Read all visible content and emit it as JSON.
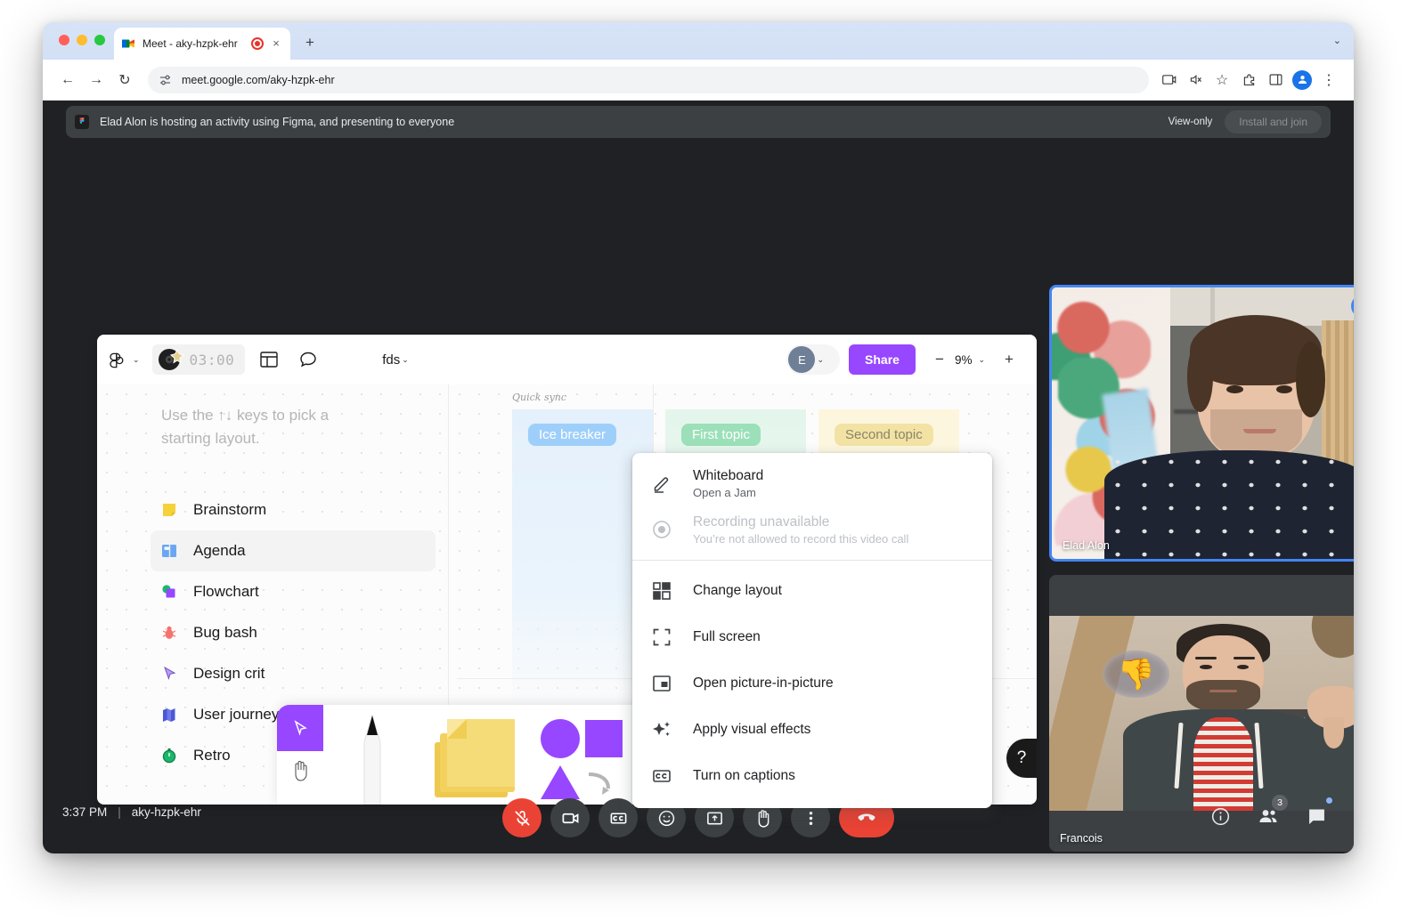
{
  "browser": {
    "tab": {
      "title": "Meet - aky-hzpk-ehr",
      "favicon": "google-meet-icon",
      "recording_indicator": "recording-icon",
      "close": "×"
    },
    "new_tab": "+",
    "chevron": "⌄",
    "nav": {
      "back": "←",
      "forward": "→",
      "reload": "↻"
    },
    "omnibox": {
      "url": "meet.google.com/aky-hzpk-ehr",
      "site_settings_icon": "tune-icon"
    },
    "actions": {
      "cast": "screencast-icon",
      "mute_tab": "tab-muted-icon",
      "bookmark": "☆",
      "extensions": "extensions-icon",
      "side_panel": "side-panel-icon",
      "profile": "profile-avatar-icon",
      "menu": "⋮"
    }
  },
  "banner": {
    "icon": "figma-icon",
    "text": "Elad Alon is hosting an activity using Figma, and presenting to everyone",
    "view_only": "View-only",
    "install_button": "Install and join"
  },
  "figma": {
    "logo": "figma-logo-icon",
    "timer": "03:00",
    "timer_badge": "music-star-icon",
    "layout_icon": "layout-grid-icon",
    "comment_icon": "comment-bubble-icon",
    "filename": "fds",
    "filename_caret": "⌄",
    "user_initial": "E",
    "user_caret": "⌄",
    "share_label": "Share",
    "zoom_minus": "−",
    "zoom_value": "9%",
    "zoom_caret": "⌄",
    "zoom_plus": "+",
    "hint": "Use the ↑↓ keys to pick a starting layout.",
    "layouts": [
      {
        "label": "Brainstorm",
        "icon": "sticky-note-icon",
        "selected": false
      },
      {
        "label": "Agenda",
        "icon": "agenda-board-icon",
        "selected": true
      },
      {
        "label": "Flowchart",
        "icon": "flowchart-shapes-icon",
        "selected": false
      },
      {
        "label": "Bug bash",
        "icon": "bug-icon",
        "selected": false
      },
      {
        "label": "Design crit",
        "icon": "cursor-pen-icon",
        "selected": false
      },
      {
        "label": "User journey",
        "icon": "map-icon",
        "selected": false
      },
      {
        "label": "Retro",
        "icon": "timer-icon",
        "selected": false
      }
    ],
    "board": {
      "title": "Quick sync",
      "columns": [
        {
          "label": "Ice breaker",
          "color": "#9ecffa"
        },
        {
          "label": "First topic",
          "color": "#9be0b8"
        },
        {
          "label": "Second topic",
          "color": "#f2e3a4"
        }
      ]
    },
    "tools": [
      {
        "name": "move-tool",
        "icon": "cursor-arrow-icon"
      },
      {
        "name": "hand-tool",
        "icon": "hand-icon"
      },
      {
        "name": "pen-tool",
        "icon": "marker-pen-icon"
      },
      {
        "name": "sticky-note-tool",
        "icon": "sticky-notes-icon"
      },
      {
        "name": "shape-tool",
        "icon": "shapes-icon"
      },
      {
        "name": "text-tool",
        "icon": "text-t-icon"
      }
    ],
    "help_label": "?"
  },
  "context_menu": {
    "items": [
      {
        "label": "Whiteboard",
        "sub": "Open a Jam",
        "icon": "pencil-icon",
        "disabled": false
      },
      {
        "label": "Recording unavailable",
        "sub": "You’re not allowed to record this video call",
        "icon": "record-circle-icon",
        "disabled": true
      },
      {
        "label": "Change layout",
        "sub": "",
        "icon": "layout-grid-icon",
        "disabled": false
      },
      {
        "label": "Full screen",
        "sub": "",
        "icon": "fullscreen-icon",
        "disabled": false
      },
      {
        "label": "Open picture-in-picture",
        "sub": "",
        "icon": "picture-in-picture-icon",
        "disabled": false
      },
      {
        "label": "Apply visual effects",
        "sub": "",
        "icon": "sparkle-icon",
        "disabled": false
      },
      {
        "label": "Turn on captions",
        "sub": "",
        "icon": "closed-captions-icon",
        "disabled": false
      }
    ]
  },
  "participants": [
    {
      "name": "Elad Alon",
      "more_icon": "more-options-icon",
      "muted": false,
      "speaking": true
    },
    {
      "name": "Francois",
      "mute_icon": "mic-off-icon",
      "muted": true,
      "speaking": false,
      "reaction": "thumbs-down-reaction"
    }
  ],
  "meet_bar": {
    "time": "3:37 PM",
    "separator": "|",
    "meeting_code": "aky-hzpk-ehr",
    "controls": [
      {
        "name": "microphone-button",
        "icon": "mic-off-icon",
        "state": "muted"
      },
      {
        "name": "camera-button",
        "icon": "camera-icon",
        "state": "on"
      },
      {
        "name": "captions-button",
        "icon": "closed-captions-icon",
        "state": "off"
      },
      {
        "name": "reactions-button",
        "icon": "emoji-smile-icon",
        "state": "off"
      },
      {
        "name": "present-button",
        "icon": "present-screen-icon",
        "state": "off"
      },
      {
        "name": "raise-hand-button",
        "icon": "hand-raise-icon",
        "state": "off"
      },
      {
        "name": "more-options-button",
        "icon": "more-vertical-icon",
        "state": "open"
      },
      {
        "name": "leave-call-button",
        "icon": "end-call-icon",
        "state": "on"
      }
    ],
    "right": [
      {
        "name": "meeting-details-button",
        "icon": "info-icon",
        "badge": ""
      },
      {
        "name": "people-button",
        "icon": "people-icon",
        "badge": "3"
      },
      {
        "name": "chat-button",
        "icon": "chat-icon",
        "badge": ""
      }
    ]
  }
}
